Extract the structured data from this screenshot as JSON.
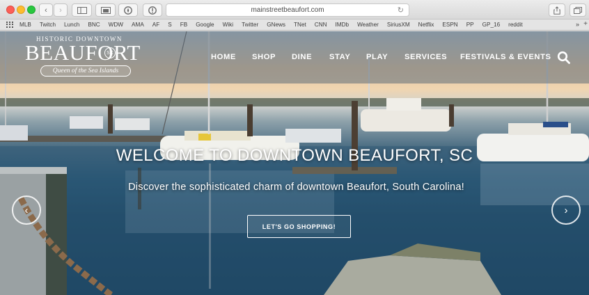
{
  "browser": {
    "url": "mainstreetbeaufort.com",
    "bookmarks": [
      "MLB",
      "Twitch",
      "Lunch",
      "BNC",
      "WDW",
      "AMA",
      "AF",
      "S",
      "FB",
      "Google",
      "Wiki",
      "Twitter",
      "GNews",
      "TNet",
      "CNN",
      "IMDb",
      "Weather",
      "SiriusXM",
      "Netflix",
      "ESPN",
      "PP",
      "GP_16",
      "reddit"
    ],
    "bookmarks_more": "»",
    "colors": {
      "close": "#fc5f57",
      "minimize": "#fdbc2e",
      "zoom": "#29c73f"
    }
  },
  "site": {
    "logo": {
      "top": "HISTORIC DOWNTOWN",
      "main": "BEAUFORT",
      "badge": "SC",
      "tagline": "Queen of the Sea Islands"
    },
    "nav": [
      "HOME",
      "SHOP",
      "DINE",
      "STAY",
      "PLAY",
      "SERVICES",
      "FESTIVALS & EVENTS"
    ],
    "hero": {
      "title": "WELCOME TO DOWNTOWN BEAUFORT, SC",
      "subtitle": "Discover the sophisticated charm of downtown Beaufort, South Carolina!",
      "cta": "LET'S GO SHOPPING!"
    },
    "icons": {
      "search": "search-icon",
      "prev": "chevron-left-icon",
      "next": "chevron-right-icon"
    }
  }
}
